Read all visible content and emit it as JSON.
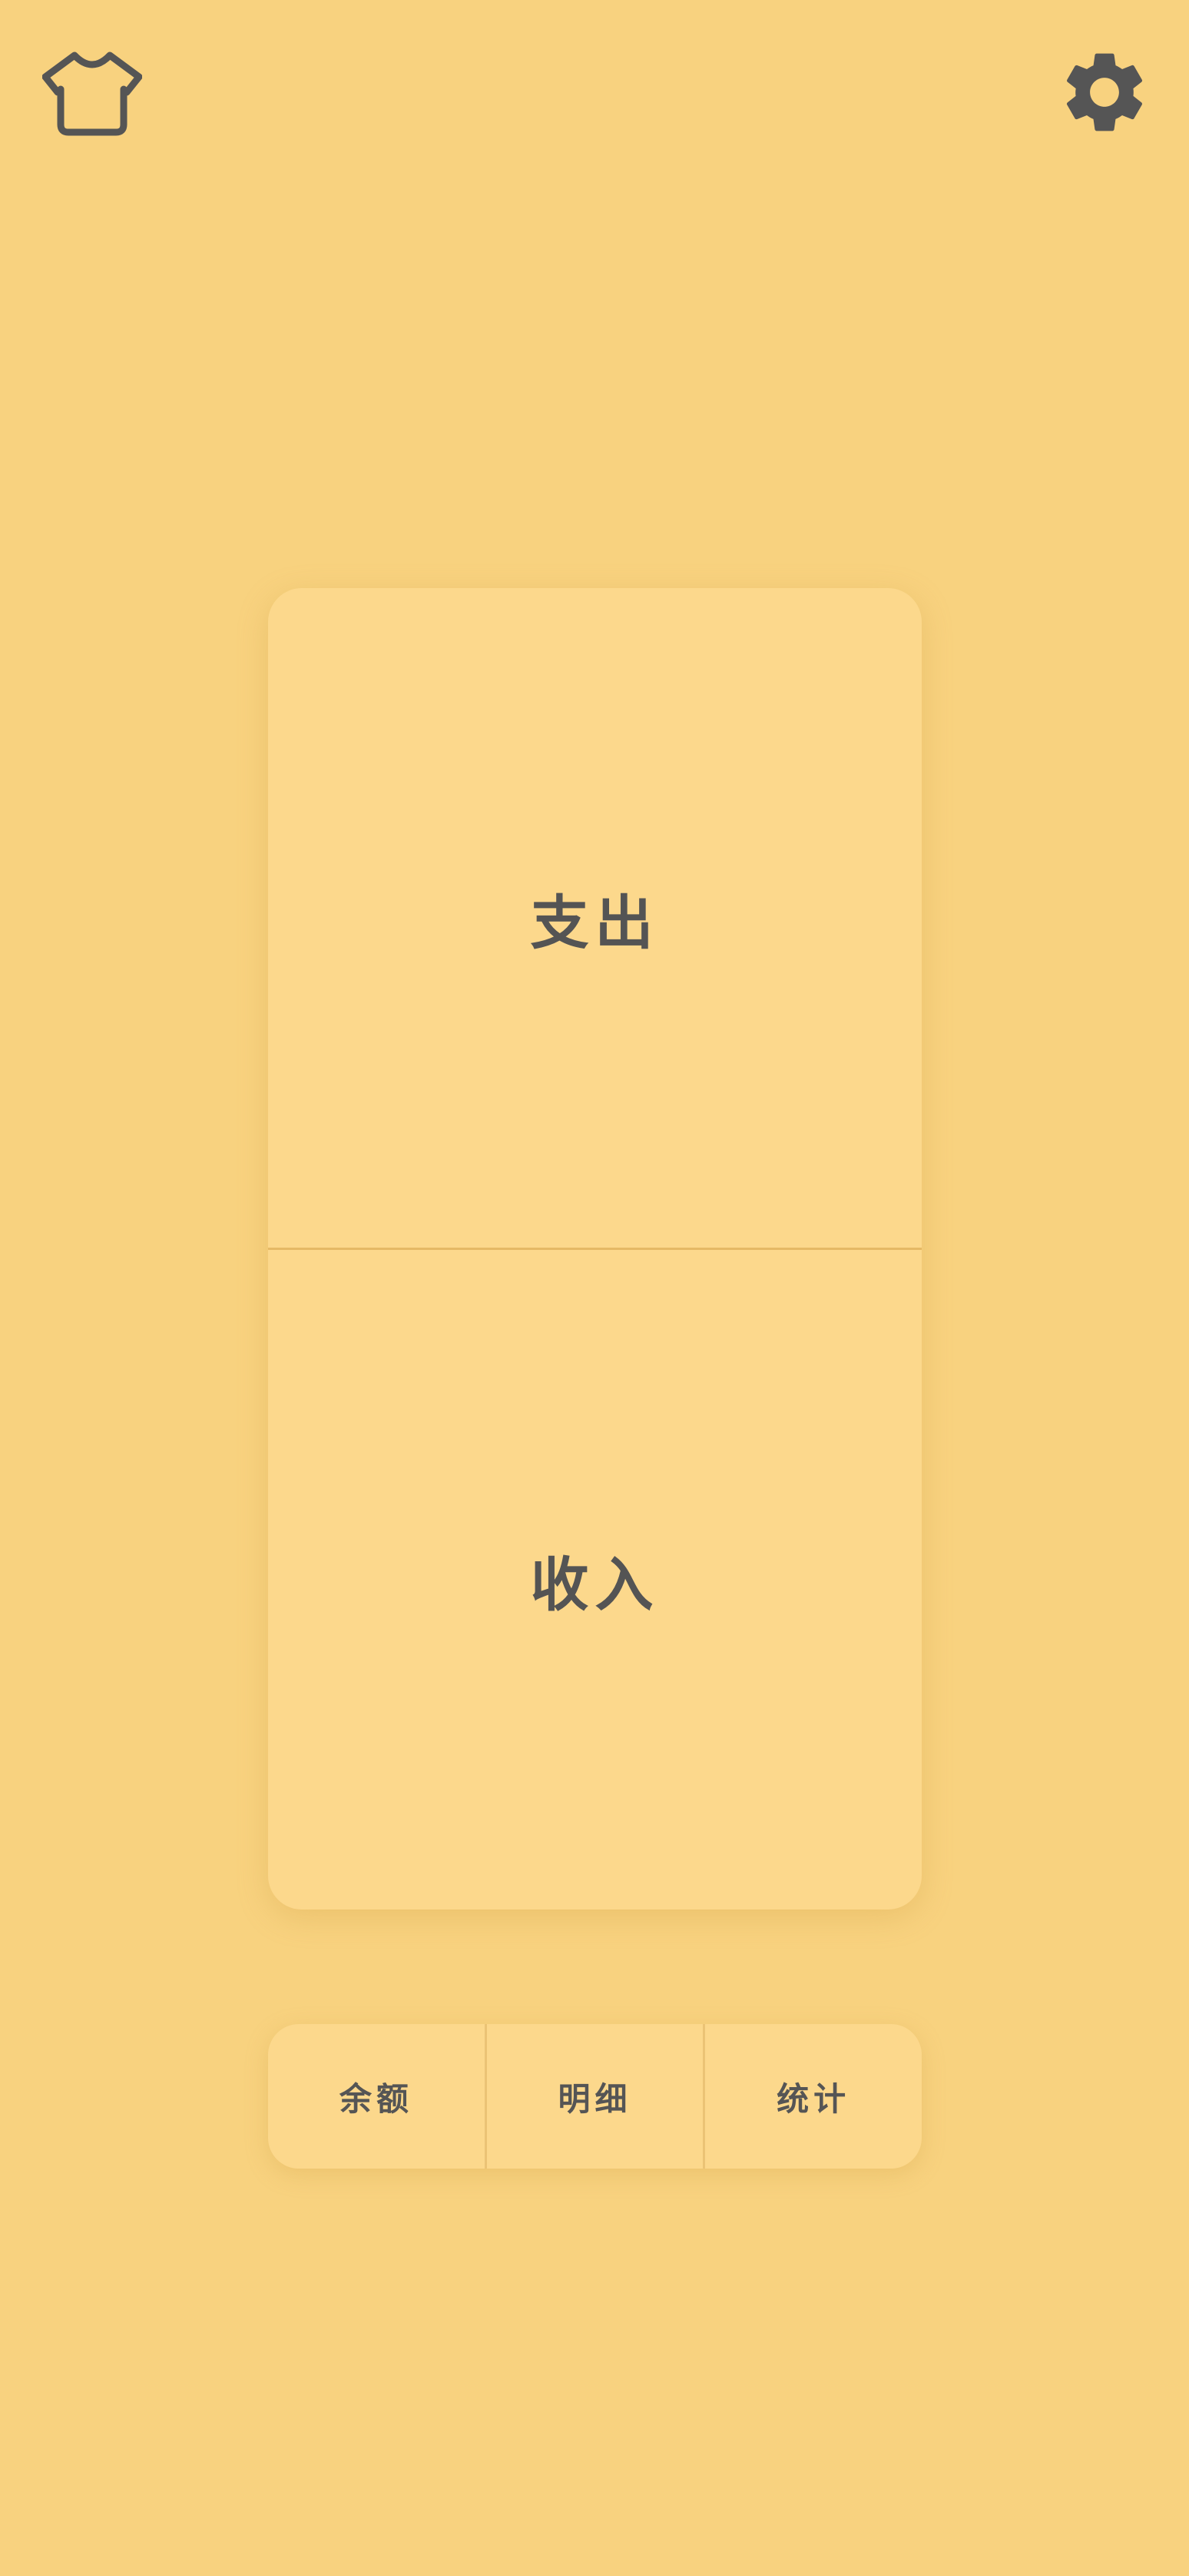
{
  "header": {
    "left_icon": "tshirt-icon",
    "right_icon": "gear-icon"
  },
  "main": {
    "expense_label": "支出",
    "income_label": "收入"
  },
  "bottom_nav": {
    "items": [
      {
        "label": "余额"
      },
      {
        "label": "明细"
      },
      {
        "label": "统计"
      }
    ]
  },
  "colors": {
    "background": "#F8D27F",
    "card": "#FCD88C",
    "text": "#555555",
    "divider": "#E5B965"
  }
}
